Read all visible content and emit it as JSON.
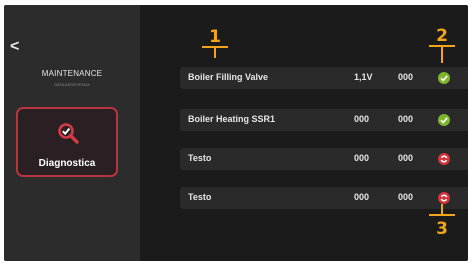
{
  "sidebar": {
    "back_glyph": "<",
    "title": "MAINTENANCE",
    "subtitle": "DATA ASSISTENZA",
    "active_item": {
      "label": "Diagnostica",
      "icon": "diagnostics-icon"
    }
  },
  "rows": [
    {
      "label": "Boiler Filling Valve",
      "value1": "1,1V",
      "value2": "000",
      "status": "ok"
    },
    {
      "label": "Boiler Heating SSR1",
      "value1": "000",
      "value2": "000",
      "status": "ok"
    },
    {
      "label": "Testo",
      "value1": "000",
      "value2": "000",
      "status": "error"
    },
    {
      "label": "Testo",
      "value1": "000",
      "value2": "000",
      "status": "error"
    }
  ],
  "annotations": [
    "1",
    "2",
    "3"
  ],
  "colors": {
    "accent": "#b8343f",
    "ok": "#7fb52c",
    "error": "#d2333c",
    "annotation": "#f2a51a"
  }
}
